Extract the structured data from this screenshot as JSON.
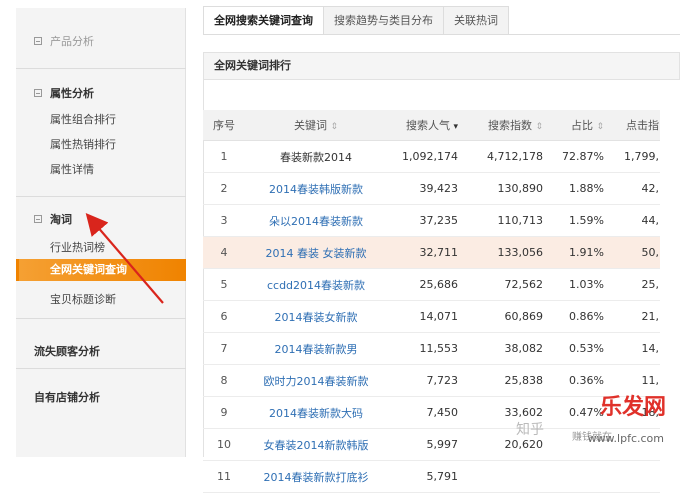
{
  "sidebar": {
    "product_analysis": "产品分析",
    "attribute": {
      "title": "属性分析",
      "items": [
        "属性组合排行",
        "属性热销排行",
        "属性详情"
      ]
    },
    "taoci": {
      "title": "淘词",
      "items": [
        "行业热词榜",
        "全网关键词查询",
        "宝贝标题诊断"
      ]
    },
    "lost_customers": "流失顾客分析",
    "own_shop": "自有店铺分析"
  },
  "tabs": [
    "全网搜索关键词查询",
    "搜索趋势与类目分布",
    "关联热词"
  ],
  "panel_title": "全网关键词排行",
  "table": {
    "headers": {
      "index": "序号",
      "keyword": "关键词",
      "popularity": "搜索人气",
      "search_index": "搜索指数",
      "share": "占比",
      "clicks": "点击指"
    },
    "rows": [
      {
        "index": "1",
        "keyword": "春装新款2014",
        "popularity": "1,092,174",
        "search_index": "4,712,178",
        "share": "72.87%",
        "clicks": "1,799,"
      },
      {
        "index": "2",
        "keyword": "2014春装韩版新款",
        "popularity": "39,423",
        "search_index": "130,890",
        "share": "1.88%",
        "clicks": "42,"
      },
      {
        "index": "3",
        "keyword": "朵以2014春装新款",
        "popularity": "37,235",
        "search_index": "110,713",
        "share": "1.59%",
        "clicks": "44,"
      },
      {
        "index": "4",
        "keyword": "2014 春装 女装新款",
        "popularity": "32,711",
        "search_index": "133,056",
        "share": "1.91%",
        "clicks": "50,"
      },
      {
        "index": "5",
        "keyword": "ccdd2014春装新款",
        "popularity": "25,686",
        "search_index": "72,562",
        "share": "1.03%",
        "clicks": "25,"
      },
      {
        "index": "6",
        "keyword": "2014春装女新款",
        "popularity": "14,071",
        "search_index": "60,869",
        "share": "0.86%",
        "clicks": "21,"
      },
      {
        "index": "7",
        "keyword": "2014春装新款男",
        "popularity": "11,553",
        "search_index": "38,082",
        "share": "0.53%",
        "clicks": "14,"
      },
      {
        "index": "8",
        "keyword": "欧时力2014春装新款",
        "popularity": "7,723",
        "search_index": "25,838",
        "share": "0.36%",
        "clicks": "11,"
      },
      {
        "index": "9",
        "keyword": "2014春装新款大码",
        "popularity": "7,450",
        "search_index": "33,602",
        "share": "0.47%",
        "clicks": "18,"
      },
      {
        "index": "10",
        "keyword": "女春装2014新款韩版",
        "popularity": "5,997",
        "search_index": "20,620",
        "share": "",
        "clicks": ""
      },
      {
        "index": "11",
        "keyword": "2014春装新款打底衫",
        "popularity": "5,791",
        "search_index": "",
        "share": "",
        "clicks": ""
      }
    ]
  },
  "watermark": {
    "zhihu": "知乎",
    "brand": "乐发网",
    "sub": "赚钱就在",
    "url": "www.lpfc.com"
  },
  "colors": {
    "accent": "#f08300",
    "link": "#2f6fb4",
    "highlight_row": "#fbece3",
    "arrow": "#d9251c"
  }
}
